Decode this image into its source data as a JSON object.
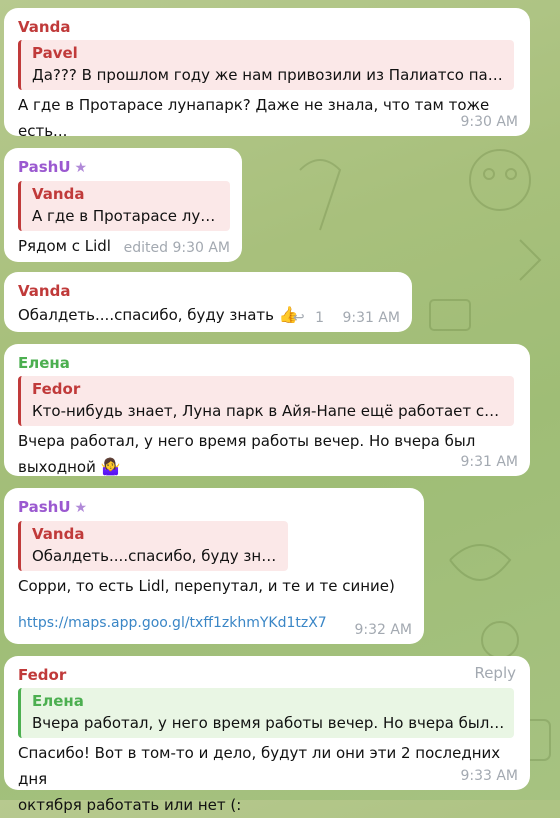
{
  "messages": [
    {
      "sender": "Vanda",
      "reply_name": "Pavel",
      "reply_text": "Да??? В прошлом году же нам привозили из Палиатсо парка...",
      "text": "А где в Протарасе лунапарк? Даже не знала, что там тоже есть...",
      "time": "9:30 AM"
    },
    {
      "sender": "PashU",
      "star": "★",
      "reply_name": "Vanda",
      "reply_text": "А где в Протарасе луна...",
      "text": "Рядом с Lidl",
      "time": "edited 9:30 AM"
    },
    {
      "sender": "Vanda",
      "text": "Обалдеть....спасибо, буду знать",
      "emoji": "👍",
      "reply_count": "1",
      "reply_arrow": "↩",
      "time": "9:31 AM"
    },
    {
      "sender": "Елена",
      "reply_name": "Fedor",
      "reply_text": "Кто-нибудь знает, Луна парк в Айя-Напе ещё работает сегод...",
      "text_line1": "Вчера работал, у него время работы вечер. Но вчера был",
      "text_line2": "выходной",
      "emoji": "🤷‍♀️",
      "time": "9:31 AM"
    },
    {
      "sender": "PashU",
      "star": "★",
      "reply_name": "Vanda",
      "reply_text": "Обалдеть....спасибо, буду знать",
      "reply_emoji": "👍",
      "text": "Сорри, то есть Lidl, перепутал, и те и те синие)",
      "link": "https://maps.app.goo.gl/txff1zkhmYKd1tzX7",
      "time": "9:32 AM"
    },
    {
      "sender": "Fedor",
      "reply_label": "Reply",
      "reply_name": "Елена",
      "reply_text": "Вчера работал, у него время работы вечер. Но вчера был вы...",
      "text_line1": "Спасибо! Вот в том-то и дело, будут ли они эти 2 последних дня",
      "text_line2": "октября работать или нет (:",
      "time": "9:33 AM"
    }
  ],
  "colors": {
    "vanda": "#c03a3a",
    "pashu": "#9b59d0",
    "elena": "#4caf50",
    "fedor": "#c03a3a",
    "pavel": "#c03a3a",
    "reply_red_bg": "#fbe8e8",
    "reply_green_bg": "#e9f6e4",
    "link": "#3a86c6",
    "meta": "#a3a9b1"
  }
}
